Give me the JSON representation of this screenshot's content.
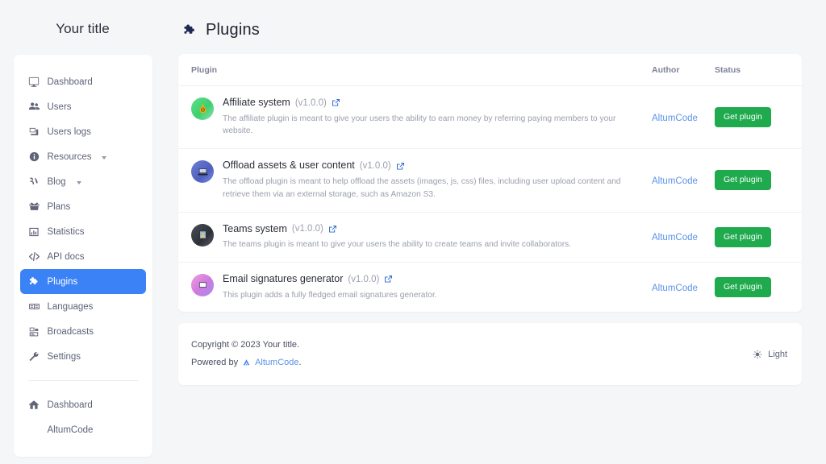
{
  "sidebar": {
    "brand_title": "Your title",
    "items": [
      {
        "label": "Dashboard",
        "icon": "monitor-icon",
        "active": false,
        "caret": false
      },
      {
        "label": "Users",
        "icon": "users-icon",
        "active": false,
        "caret": false
      },
      {
        "label": "Users logs",
        "icon": "user-logs-icon",
        "active": false,
        "caret": false
      },
      {
        "label": "Resources",
        "icon": "info-icon",
        "active": false,
        "caret": true
      },
      {
        "label": "Blog",
        "icon": "blog-icon",
        "active": false,
        "caret": true
      },
      {
        "label": "Plans",
        "icon": "plans-icon",
        "active": false,
        "caret": false
      },
      {
        "label": "Statistics",
        "icon": "chart-bar-icon",
        "active": false,
        "caret": false
      },
      {
        "label": "API docs",
        "icon": "code-icon",
        "active": false,
        "caret": false
      },
      {
        "label": "Plugins",
        "icon": "puzzle-icon",
        "active": true,
        "caret": false
      },
      {
        "label": "Languages",
        "icon": "languages-icon",
        "active": false,
        "caret": false
      },
      {
        "label": "Broadcasts",
        "icon": "broadcast-icon",
        "active": false,
        "caret": false
      },
      {
        "label": "Settings",
        "icon": "wrench-icon",
        "active": false,
        "caret": false
      }
    ],
    "bottom_items": [
      {
        "label": "Dashboard",
        "icon": "home-icon"
      },
      {
        "label": "AltumCode",
        "icon": "none"
      }
    ]
  },
  "header": {
    "title": "Plugins",
    "icon": "puzzle-icon"
  },
  "table": {
    "columns": {
      "plugin": "Plugin",
      "author": "Author",
      "status": "Status"
    },
    "rows": [
      {
        "name": "Affiliate system",
        "version": "(v1.0.0)",
        "description": "The affiliate plugin is meant to give your users the ability to earn money by referring paying members to your website.",
        "author": "AltumCode",
        "action_label": "Get plugin",
        "avatar_icon": "money-bag-icon",
        "avatar_class": "av-affiliate"
      },
      {
        "name": "Offload assets & user content",
        "version": "(v1.0.0)",
        "description": "The offload plugin is meant to help offload the assets (images, js, css) files, including user upload content and retrieve them via an external storage, such as Amazon S3.",
        "author": "AltumCode",
        "action_label": "Get plugin",
        "avatar_icon": "laptop-icon",
        "avatar_class": "av-offload"
      },
      {
        "name": "Teams system",
        "version": "(v1.0.0)",
        "description": "The teams plugin is meant to give your users the ability to create teams and invite collaborators.",
        "author": "AltumCode",
        "action_label": "Get plugin",
        "avatar_icon": "person-badge-icon",
        "avatar_class": "av-teams"
      },
      {
        "name": "Email signatures generator",
        "version": "(v1.0.0)",
        "description": "This plugin adds a fully fledged email signatures generator.",
        "author": "AltumCode",
        "action_label": "Get plugin",
        "avatar_icon": "envelope-card-icon",
        "avatar_class": "av-email"
      }
    ]
  },
  "footer": {
    "copyright": "Copyright © 2023 Your title.",
    "powered_prefix": "Powered by",
    "powered_link": "AltumCode",
    "powered_suffix": ".",
    "theme_label": "Light",
    "theme_icon": "sun-icon"
  },
  "colors": {
    "accent_blue": "#3b82f6",
    "link_blue": "#5b93e8",
    "button_green": "#1faa4e",
    "page_bg": "#f5f6f8",
    "card_bg": "#ffffff",
    "muted_text": "#9a9fae"
  }
}
